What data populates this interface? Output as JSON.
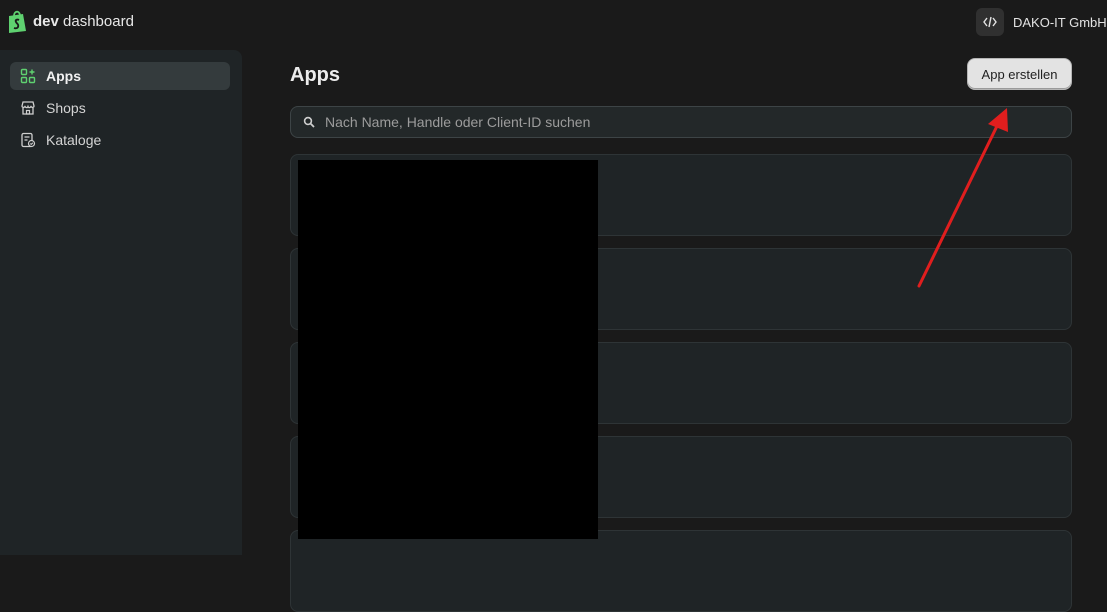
{
  "header": {
    "brand_bold": "dev",
    "brand_rest": " dashboard",
    "org_name": "DAKO-IT GmbH",
    "logo_icon": "shopify-bag-icon",
    "org_icon": "code-icon",
    "accent": "#5fd170"
  },
  "sidebar": {
    "items": [
      {
        "label": "Apps",
        "icon": "apps-grid-icon",
        "active": true
      },
      {
        "label": "Shops",
        "icon": "store-icon",
        "active": false
      },
      {
        "label": "Kataloge",
        "icon": "catalog-icon",
        "active": false
      }
    ]
  },
  "main": {
    "title": "Apps",
    "create_button": "App erstellen",
    "search": {
      "placeholder": "Nach Name, Handle oder Client-ID suchen",
      "value": ""
    },
    "app_cards_count_visible": 5
  },
  "annotation": {
    "arrow_color": "#e01e1e"
  }
}
